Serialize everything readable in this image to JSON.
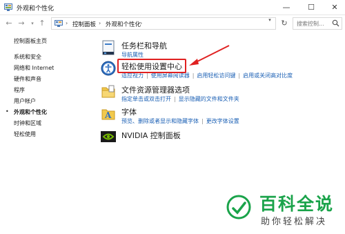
{
  "window": {
    "title": "外观和个性化",
    "controls": {
      "minimize": "—",
      "maximize": "☐",
      "close": "✕"
    }
  },
  "address": {
    "nav": {
      "back": "←",
      "forward": "→",
      "dropdown": "▾",
      "up": "↑"
    },
    "breadcrumbs": [
      "控制面板",
      "外观和个性化"
    ],
    "separator": "›",
    "refresh": "↻",
    "search_placeholder": "搜索控制..."
  },
  "sidebar": {
    "home": "控制面板主页",
    "items": [
      {
        "label": "系统和安全"
      },
      {
        "label": "网络和 Internet"
      },
      {
        "label": "硬件和声音"
      },
      {
        "label": "程序"
      },
      {
        "label": "用户帐户"
      },
      {
        "label": "外观和个性化",
        "current": true
      },
      {
        "label": "时钟和区域"
      },
      {
        "label": "轻松使用"
      }
    ],
    "bullet": "•"
  },
  "categories": [
    {
      "title": "任务栏和导航",
      "links": [
        "导航属性"
      ],
      "icon": "taskbar-icon"
    },
    {
      "title": "轻松使用设置中心",
      "links": [
        "适应视力",
        "使用屏幕阅读器",
        "启用轻松访问键",
        "启用或关闭高对比度"
      ],
      "icon": "ease-of-access-icon"
    },
    {
      "title": "文件资源管理器选项",
      "links": [
        "指定单击或双击打开",
        "显示隐藏的文件和文件夹"
      ],
      "icon": "folder-options-icon"
    },
    {
      "title": "字体",
      "links": [
        "预览、删除或者显示和隐藏字体",
        "更改字体设置"
      ],
      "icon": "fonts-icon"
    },
    {
      "title": "NVIDIA 控制面板",
      "links": [],
      "icon": "nvidia-icon"
    }
  ],
  "annotation": {
    "color": "#e02020"
  },
  "watermark": {
    "title": "百科全说",
    "subtitle": "助你轻松解决",
    "color": "#1aa34a"
  }
}
